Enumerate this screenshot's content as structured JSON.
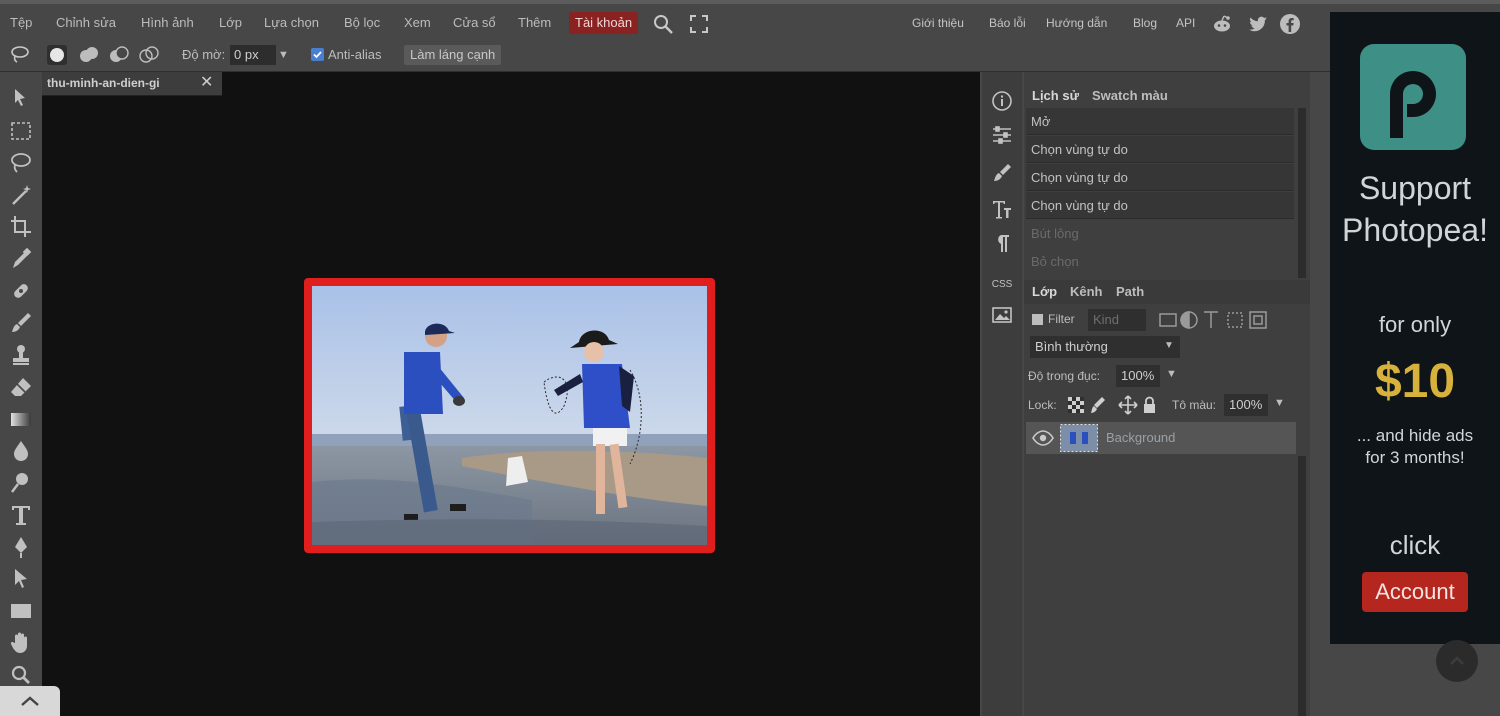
{
  "menu": {
    "items": [
      "Tệp",
      "Chỉnh sửa",
      "Hình ảnh",
      "Lớp",
      "Lựa chọn",
      "Bộ lọc",
      "Xem",
      "Cửa sổ",
      "Thêm"
    ],
    "account": "Tài khoản"
  },
  "links": [
    "Giới thiệu",
    "Báo lỗi",
    "Hướng dẫn",
    "Blog",
    "API"
  ],
  "options": {
    "feather_label": "Độ mờ:",
    "feather_value": "0 px",
    "antialias_label": "Anti-alias",
    "antialias_checked": true,
    "refine_button": "Làm láng cạnh"
  },
  "document": {
    "tab_title": "thu-minh-an-dien-gi",
    "close": "✕"
  },
  "history": {
    "tabs": [
      "Lịch sử",
      "Swatch màu"
    ],
    "items": [
      {
        "label": "Mở",
        "active": true
      },
      {
        "label": "Chọn vùng tự do",
        "active": true
      },
      {
        "label": "Chọn vùng tự do",
        "active": true
      },
      {
        "label": "Chọn vùng tự do",
        "active": true
      },
      {
        "label": "Bút lông",
        "active": false
      },
      {
        "label": "Bỏ chọn",
        "active": false
      }
    ]
  },
  "layers": {
    "tabs": [
      "Lớp",
      "Kênh",
      "Path"
    ],
    "filter_label": "Filter",
    "filter_kind": "Kind",
    "blend_mode": "Bình thường",
    "opacity_label": "Độ trong đục:",
    "opacity_value": "100%",
    "lock_label": "Lock:",
    "fill_label": "Tô màu:",
    "fill_value": "100%",
    "layer_name": "Background"
  },
  "side_panel": {
    "css_label": "CSS"
  },
  "ad": {
    "line1": "Support",
    "line2": "Photopea!",
    "for_only": "for only",
    "price": "$10",
    "hide_line1": "... and hide ads",
    "hide_line2": "for 3 months!",
    "click": "click",
    "button": "Account"
  },
  "colors": {
    "accent_red": "#e01e1e",
    "account_tab": "#8a2222",
    "logo_teal": "#3e8f86",
    "price_gold": "#d6b13c",
    "ad_button": "#b5261e"
  }
}
